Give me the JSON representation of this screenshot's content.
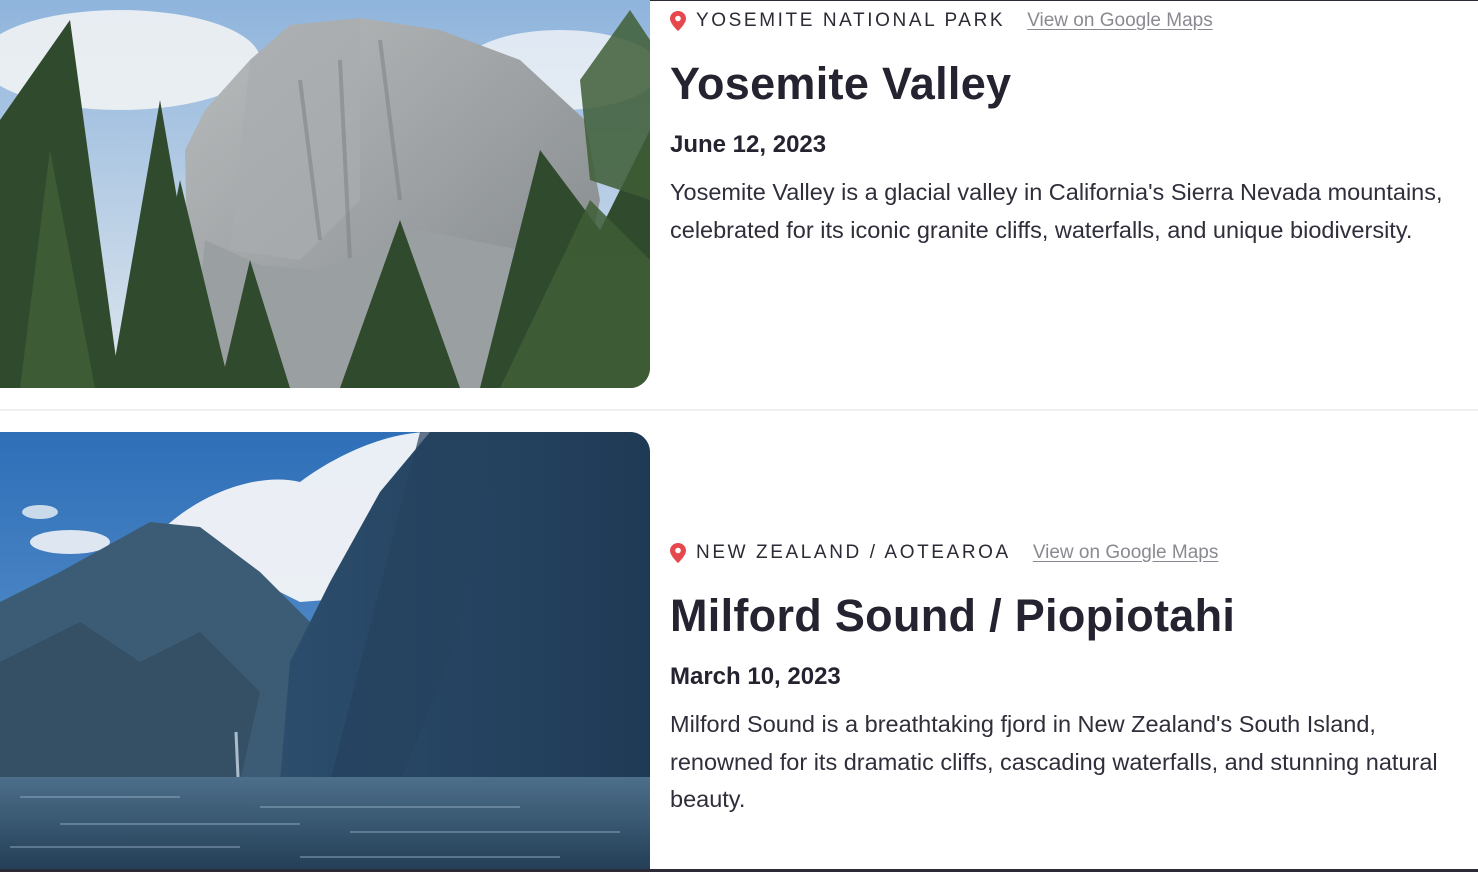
{
  "entries": [
    {
      "location": "YOSEMITE NATIONAL PARK",
      "maps_link": "View on Google Maps",
      "title": "Yosemite Valley",
      "date": "June 12, 2023",
      "description": "Yosemite Valley is a glacial valley in California's Sierra Nevada mountains, celebrated for its iconic granite cliffs, waterfalls, and unique biodiversity.",
      "photo_subject": "Half Dome granite cliff with pine trees"
    },
    {
      "location": "NEW ZEALAND / AOTEAROA",
      "maps_link": "View on Google Maps",
      "title": "Milford Sound / Piopiotahi",
      "date": "March 10, 2023",
      "description": "Milford Sound is a breathtaking fjord in New Zealand's South Island, renowned for its dramatic cliffs, cascading waterfalls, and stunning natural beauty.",
      "photo_subject": "Fjord with steep mountains and cloud-capped peak"
    }
  ],
  "icons": {
    "location": "map-pin-icon"
  },
  "colors": {
    "pin": "#e5484d",
    "text": "#2b2a35",
    "link": "#8a8991"
  }
}
